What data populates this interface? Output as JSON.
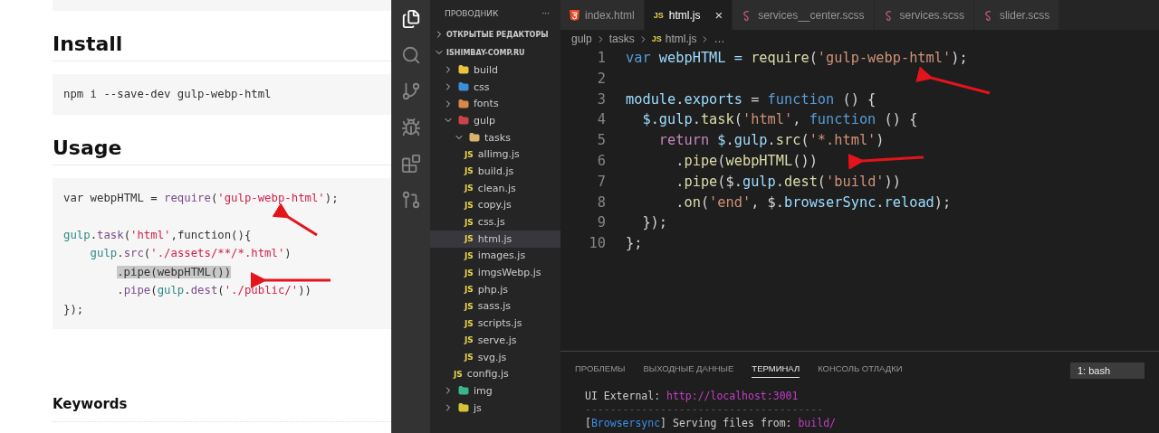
{
  "readme": {
    "sections": [
      {
        "heading": "Install",
        "code": [
          {
            "kind": "none",
            "tokens": [
              {
                "t": "npm i --save-dev gulp-webp-html",
                "kind": "plain"
              }
            ]
          }
        ]
      },
      {
        "heading": "Usage",
        "code": [
          {
            "kind": "none",
            "tokens": [
              {
                "t": "var webpHTML = ",
                "kind": "plain"
              },
              {
                "t": "require",
                "kind": "fn"
              },
              {
                "t": "(",
                "kind": "plain"
              },
              {
                "t": "'gulp-webp-html'",
                "kind": "str"
              },
              {
                "t": ");",
                "kind": "plain"
              }
            ]
          },
          {
            "kind": "blank"
          },
          {
            "kind": "none",
            "tokens": [
              {
                "t": "gulp",
                "kind": "obj"
              },
              {
                "t": ".",
                "kind": "plain"
              },
              {
                "t": "task",
                "kind": "fn"
              },
              {
                "t": "(",
                "kind": "plain"
              },
              {
                "t": "'html'",
                "kind": "str"
              },
              {
                "t": ",function(){",
                "kind": "plain"
              }
            ]
          },
          {
            "kind": "single",
            "tokens": [
              {
                "t": "gulp",
                "kind": "obj"
              },
              {
                "t": ".",
                "kind": "plain"
              },
              {
                "t": "src",
                "kind": "fn"
              },
              {
                "t": "(",
                "kind": "plain"
              },
              {
                "t": "'./assets/**/*.html'",
                "kind": "str"
              },
              {
                "t": ")",
                "kind": "plain"
              }
            ]
          },
          {
            "kind": "double",
            "tokens": [
              {
                "t": ".pipe(webpHTML())",
                "kind": "highlight"
              }
            ]
          },
          {
            "kind": "double",
            "tokens": [
              {
                "t": ".",
                "kind": "plain"
              },
              {
                "t": "pipe",
                "kind": "fn"
              },
              {
                "t": "(",
                "kind": "plain"
              },
              {
                "t": "gulp",
                "kind": "obj"
              },
              {
                "t": ".",
                "kind": "plain"
              },
              {
                "t": "dest",
                "kind": "fn"
              },
              {
                "t": "(",
                "kind": "plain"
              },
              {
                "t": "'./public/'",
                "kind": "str"
              },
              {
                "t": "))",
                "kind": "plain"
              }
            ]
          },
          {
            "kind": "none",
            "tokens": [
              {
                "t": "});",
                "kind": "plain"
              }
            ]
          }
        ]
      }
    ],
    "keywords_heading": "Keywords"
  },
  "editor": {
    "explorer": {
      "title": "ПРОВОДНИК",
      "more": "···",
      "open_editors": {
        "label": "ОТКРЫТЫЕ РЕДАКТОРЫ",
        "expanded": false
      },
      "project": {
        "label": "ISHIMBAY-COMP.RU",
        "expanded": true
      },
      "tree": [
        {
          "name": "build",
          "kind": "folder",
          "color": "#e8c33c",
          "expanded": false,
          "selected": false
        },
        {
          "name": "css",
          "kind": "folder",
          "color": "#3a8fd6",
          "expanded": false,
          "selected": false
        },
        {
          "name": "fonts",
          "kind": "folder",
          "color": "#d9874a",
          "expanded": false,
          "selected": false
        },
        {
          "name": "gulp",
          "kind": "folder",
          "color": "#c9444a",
          "expanded": true,
          "selected": false,
          "children": [
            {
              "name": "tasks",
              "kind": "folder",
              "color": "#d7b46a",
              "expanded": true,
              "selected": false,
              "children": [
                {
                  "name": "allimg.js",
                  "kind": "js",
                  "badge": "JS",
                  "selected": false
                },
                {
                  "name": "build.js",
                  "kind": "js",
                  "badge": "JS",
                  "selected": false
                },
                {
                  "name": "clean.js",
                  "kind": "js",
                  "badge": "JS",
                  "selected": false
                },
                {
                  "name": "copy.js",
                  "kind": "js",
                  "badge": "JS",
                  "selected": false
                },
                {
                  "name": "css.js",
                  "kind": "js",
                  "badge": "JS",
                  "selected": false
                },
                {
                  "name": "html.js",
                  "kind": "js",
                  "badge": "JS",
                  "selected": true
                },
                {
                  "name": "images.js",
                  "kind": "js",
                  "badge": "JS",
                  "selected": false
                },
                {
                  "name": "imgsWebp.js",
                  "kind": "js",
                  "badge": "JS",
                  "selected": false
                },
                {
                  "name": "php.js",
                  "kind": "js",
                  "badge": "JS",
                  "selected": false
                },
                {
                  "name": "sass.js",
                  "kind": "js",
                  "badge": "JS",
                  "selected": false
                },
                {
                  "name": "scripts.js",
                  "kind": "js",
                  "badge": "JS",
                  "selected": false
                },
                {
                  "name": "serve.js",
                  "kind": "js",
                  "badge": "JS",
                  "selected": false
                },
                {
                  "name": "svg.js",
                  "kind": "js",
                  "badge": "JS",
                  "selected": false
                }
              ]
            },
            {
              "name": "config.js",
              "kind": "js",
              "badge": "JS",
              "selected": false
            }
          ]
        },
        {
          "name": "img",
          "kind": "folder",
          "color": "#3bb58f",
          "expanded": false,
          "selected": false
        },
        {
          "name": "js",
          "kind": "folder",
          "color": "#d6c23a",
          "expanded": false,
          "selected": false
        }
      ]
    },
    "tabs": [
      {
        "label": "index.html",
        "kind": "html",
        "selected": false
      },
      {
        "label": "html.js",
        "kind": "js",
        "badge": "JS",
        "selected": true,
        "close": "×"
      },
      {
        "label": "services__center.scss",
        "kind": "scss",
        "selected": false
      },
      {
        "label": "services.scss",
        "kind": "scss",
        "selected": false
      },
      {
        "label": "slider.scss",
        "kind": "scss",
        "selected": false
      }
    ],
    "breadcrumbs": [
      {
        "label": "gulp"
      },
      {
        "label": "tasks"
      },
      {
        "label": "html.js",
        "badge": "JS"
      },
      {
        "label": "…"
      }
    ],
    "code": [
      {
        "n": "1",
        "kind": "none",
        "tokens": [
          {
            "t": "var",
            "kind": "kw"
          },
          {
            "t": " webpHTML = ",
            "kind": "var"
          },
          {
            "t": "require",
            "kind": "fn"
          },
          {
            "t": "(",
            "kind": "plain"
          },
          {
            "t": "'gulp-webp-html'",
            "kind": "str"
          },
          {
            "t": ");",
            "kind": "plain"
          }
        ]
      },
      {
        "n": "2"
      },
      {
        "n": "3",
        "kind": "none",
        "tokens": [
          {
            "t": "module",
            "kind": "var"
          },
          {
            "t": ".",
            "kind": "plain"
          },
          {
            "t": "exports",
            "kind": "var"
          },
          {
            "t": " = ",
            "kind": "plain"
          },
          {
            "t": "function",
            "kind": "kw"
          },
          {
            "t": " () {",
            "kind": "plain"
          }
        ]
      },
      {
        "n": "4",
        "kind": "single",
        "tokens": [
          {
            "t": "$",
            "kind": "var"
          },
          {
            "t": ".",
            "kind": "plain"
          },
          {
            "t": "gulp",
            "kind": "var"
          },
          {
            "t": ".",
            "kind": "plain"
          },
          {
            "t": "task",
            "kind": "fn"
          },
          {
            "t": "(",
            "kind": "plain"
          },
          {
            "t": "'html'",
            "kind": "str"
          },
          {
            "t": ", ",
            "kind": "plain"
          },
          {
            "t": "function",
            "kind": "kw"
          },
          {
            "t": " () {",
            "kind": "plain"
          }
        ]
      },
      {
        "n": "5",
        "kind": "double",
        "tokens": [
          {
            "t": "return",
            "kind": "ctl"
          },
          {
            "t": " $",
            "kind": "var"
          },
          {
            "t": ".",
            "kind": "plain"
          },
          {
            "t": "gulp",
            "kind": "var"
          },
          {
            "t": ".",
            "kind": "plain"
          },
          {
            "t": "src",
            "kind": "fn"
          },
          {
            "t": "(",
            "kind": "plain"
          },
          {
            "t": "'*.html'",
            "kind": "str"
          },
          {
            "t": ")",
            "kind": "plain"
          }
        ]
      },
      {
        "n": "6",
        "kind": "triple",
        "tokens": [
          {
            "t": ".",
            "kind": "plain"
          },
          {
            "t": "pipe",
            "kind": "fn"
          },
          {
            "t": "(",
            "kind": "plain"
          },
          {
            "t": "webpHTML",
            "kind": "fn"
          },
          {
            "t": "())",
            "kind": "plain"
          }
        ]
      },
      {
        "n": "7",
        "kind": "triple",
        "tokens": [
          {
            "t": ".",
            "kind": "plain"
          },
          {
            "t": "pipe",
            "kind": "fn"
          },
          {
            "t": "($",
            "kind": "plain"
          },
          {
            "t": ".",
            "kind": "plain"
          },
          {
            "t": "gulp",
            "kind": "var"
          },
          {
            "t": ".",
            "kind": "plain"
          },
          {
            "t": "dest",
            "kind": "fn"
          },
          {
            "t": "(",
            "kind": "plain"
          },
          {
            "t": "'build'",
            "kind": "str"
          },
          {
            "t": "))",
            "kind": "plain"
          }
        ]
      },
      {
        "n": "8",
        "kind": "triple",
        "tokens": [
          {
            "t": ".",
            "kind": "plain"
          },
          {
            "t": "on",
            "kind": "fn"
          },
          {
            "t": "(",
            "kind": "plain"
          },
          {
            "t": "'end'",
            "kind": "str"
          },
          {
            "t": ", $",
            "kind": "plain"
          },
          {
            "t": ".",
            "kind": "plain"
          },
          {
            "t": "browserSync",
            "kind": "var"
          },
          {
            "t": ".",
            "kind": "plain"
          },
          {
            "t": "reload",
            "kind": "var"
          },
          {
            "t": ");",
            "kind": "plain"
          }
        ]
      },
      {
        "n": "9",
        "kind": "single",
        "tokens": [
          {
            "t": "});",
            "kind": "plain"
          }
        ]
      },
      {
        "n": "10",
        "kind": "none",
        "tokens": [
          {
            "t": "};",
            "kind": "plain"
          }
        ]
      }
    ],
    "panel": {
      "tabs": [
        {
          "label": "ПРОБЛЕМЫ",
          "selected": false
        },
        {
          "label": "ВЫХОДНЫЕ ДАННЫЕ",
          "selected": false
        },
        {
          "label": "ТЕРМИНАЛ",
          "selected": true
        },
        {
          "label": "КОНСОЛЬ ОТЛАДКИ",
          "selected": false
        }
      ],
      "terminal_select": "1: bash",
      "lines": [
        [
          {
            "t": "UI External: ",
            "kind": "plain"
          },
          {
            "t": "http://localhost:3001",
            "kind": "magenta"
          }
        ],
        [
          {
            "t": "--------------------------------------",
            "kind": "dim"
          }
        ],
        [
          {
            "t": "[",
            "kind": "plain"
          },
          {
            "t": "Browsersync",
            "kind": "blue"
          },
          {
            "t": "] Serving files from: ",
            "kind": "plain"
          },
          {
            "t": "build/",
            "kind": "magenta"
          }
        ]
      ]
    }
  }
}
